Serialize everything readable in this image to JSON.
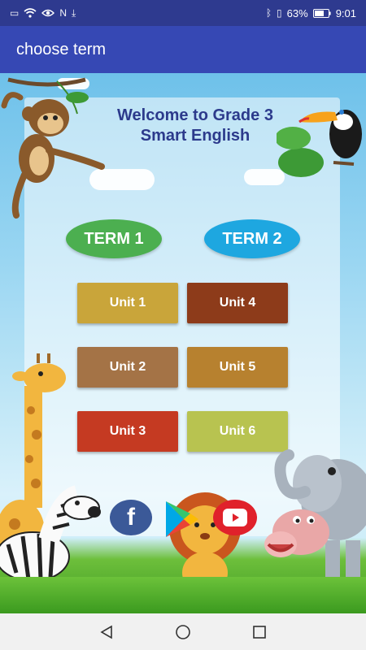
{
  "status_bar": {
    "battery": "63%",
    "time": "9:01"
  },
  "app_bar": {
    "title": "choose term"
  },
  "header": {
    "title_line1": "Welcome to Grade 3",
    "title_line2": "Smart English"
  },
  "terms": [
    {
      "label": "TERM 1",
      "color": "#4caf50"
    },
    {
      "label": "TERM 2",
      "color": "#1ea7e0"
    }
  ],
  "units": [
    {
      "label": "Unit 1",
      "color": "#c9a53a"
    },
    {
      "label": "Unit 2",
      "color": "#a47346"
    },
    {
      "label": "Unit 3",
      "color": "#c53a22"
    },
    {
      "label": "Unit 4",
      "color": "#8d3b1a"
    },
    {
      "label": "Unit 5",
      "color": "#b7812f"
    },
    {
      "label": "Unit 6",
      "color": "#b8c350"
    }
  ],
  "social": {
    "facebook_letter": "f"
  },
  "icons": [
    "wifi-icon",
    "eye-icon",
    "nfc-icon",
    "download-icon",
    "bluetooth-icon",
    "vibrate-icon",
    "battery-icon",
    "facebook-icon",
    "play-store-icon",
    "youtube-icon",
    "back-icon",
    "home-icon",
    "recents-icon"
  ]
}
